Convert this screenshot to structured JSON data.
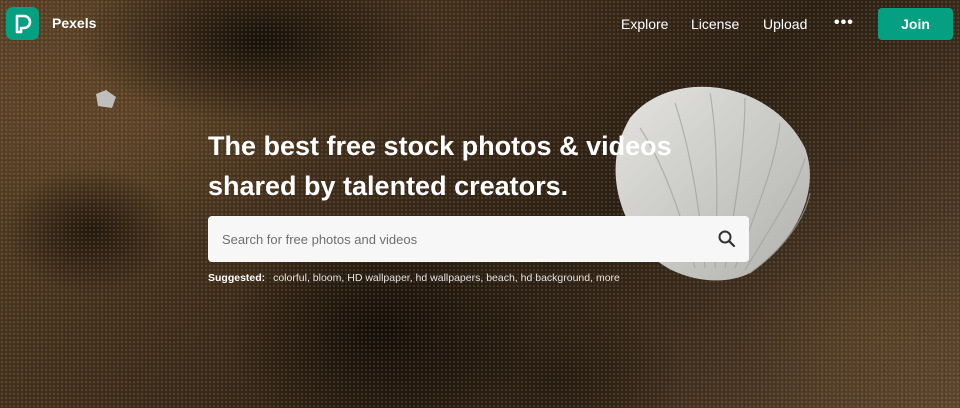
{
  "brand": {
    "name": "Pexels"
  },
  "nav": {
    "links": [
      "Explore",
      "License",
      "Upload"
    ],
    "more_label": "•••",
    "join_label": "Join"
  },
  "hero": {
    "headline_line1": "The best free stock photos & videos",
    "headline_line2": "shared by talented creators."
  },
  "search": {
    "placeholder": "Search for free photos and videos",
    "value": ""
  },
  "suggested": {
    "label": "Suggested:",
    "items": [
      "colorful",
      "bloom",
      "HD wallpaper",
      "hd wallpapers",
      "beach",
      "hd background",
      "more"
    ]
  },
  "colors": {
    "accent": "#05a081",
    "search_bg": "#f7f7f7"
  },
  "icons": {
    "logo": "pexels-logo-icon",
    "search": "search-icon",
    "more": "more-dots-icon"
  }
}
